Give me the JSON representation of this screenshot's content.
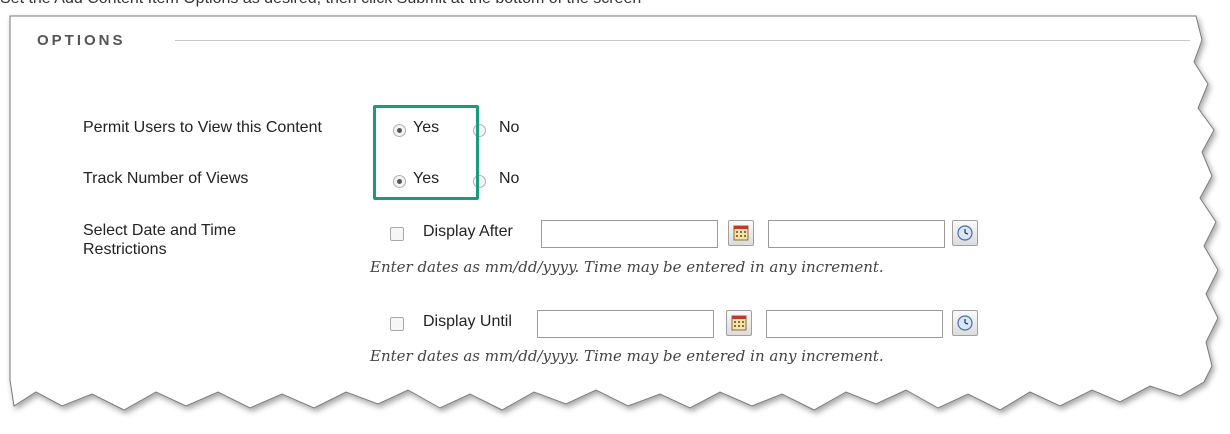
{
  "header": {
    "cutoff_text": "Set the Add Content Item Options as desired, then click Submit at the bottom of the screen"
  },
  "options": {
    "section_title": "OPTIONS",
    "permit_view": {
      "label": "Permit Users to View this Content",
      "yes_label": "Yes",
      "no_label": "No",
      "selected": "Yes"
    },
    "track_views": {
      "label": "Track Number of Views",
      "yes_label": "Yes",
      "no_label": "No",
      "selected": "Yes"
    },
    "date_restrictions": {
      "label": "Select Date and Time Restrictions",
      "display_after": {
        "label": "Display After",
        "checked": false,
        "date_value": "",
        "time_value": "",
        "hint": "Enter dates as mm/dd/yyyy. Time may be entered in any increment."
      },
      "display_until": {
        "label": "Display Until",
        "checked": false,
        "date_value": "",
        "time_value": "",
        "hint": "Enter dates as mm/dd/yyyy. Time may be entered in any increment."
      }
    }
  },
  "icons": {
    "calendar": "calendar-icon",
    "clock": "clock-icon"
  },
  "colors": {
    "highlight_border": "#1a9c7c",
    "section_title": "#555555"
  }
}
